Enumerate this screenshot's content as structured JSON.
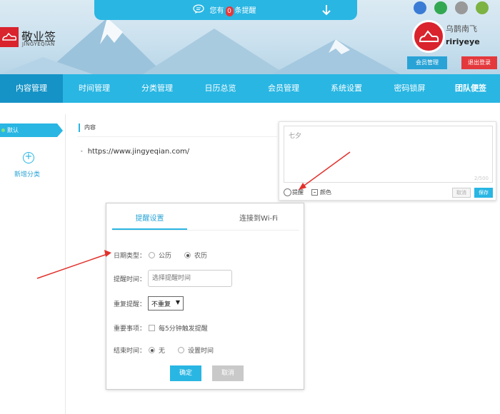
{
  "header": {
    "notice": {
      "prefix": "您有",
      "count": "0",
      "suffix": "条提醒"
    },
    "logo": {
      "title": "敬业签",
      "subtitle": "JINGYEQIAN"
    },
    "os_links": [
      "ie-icon",
      "windows-icon",
      "apple-icon",
      "android-icon"
    ],
    "user": {
      "display_name": "乌鹊南飞",
      "username": "ririyeye"
    },
    "member_button": "会员管理",
    "logout_button": "退出登录"
  },
  "nav": {
    "items": [
      "内容管理",
      "时间管理",
      "分类管理",
      "日历总览",
      "会员管理",
      "系统设置",
      "密码锁屏",
      "团队便签"
    ]
  },
  "sidebar": {
    "default_label": "默认",
    "add_label": "新增分类"
  },
  "content": {
    "heading": "内容",
    "url": "https://www.jingyeqian.com/"
  },
  "editor": {
    "text": "七夕",
    "count": "2/500",
    "remind_label": "提醒",
    "color_label": "颜色",
    "cancel_label": "取消",
    "save_label": "保存"
  },
  "popup": {
    "tab_active": "提醒设置",
    "tab_other": "连接到Wi-Fi",
    "date_type_label": "日期类型：",
    "date_type_options": [
      "公历",
      "农历"
    ],
    "date_type_selected": "农历",
    "time_label": "提醒时间：",
    "time_placeholder": "选择提醒时间",
    "repeat_label": "重复提醒：",
    "repeat_value": "不重复",
    "important_label": "重要事项：",
    "important_option": "每5分钟触发提醒",
    "end_label": "结束时间：",
    "end_options": [
      "无",
      "设置时间"
    ],
    "ok_label": "确定",
    "cancel_label": "取消"
  },
  "colors": {
    "accent": "#29b6e3",
    "nav_active": "#1593c6",
    "logo_red": "#d9232d",
    "logout_red": "#e4393c"
  }
}
